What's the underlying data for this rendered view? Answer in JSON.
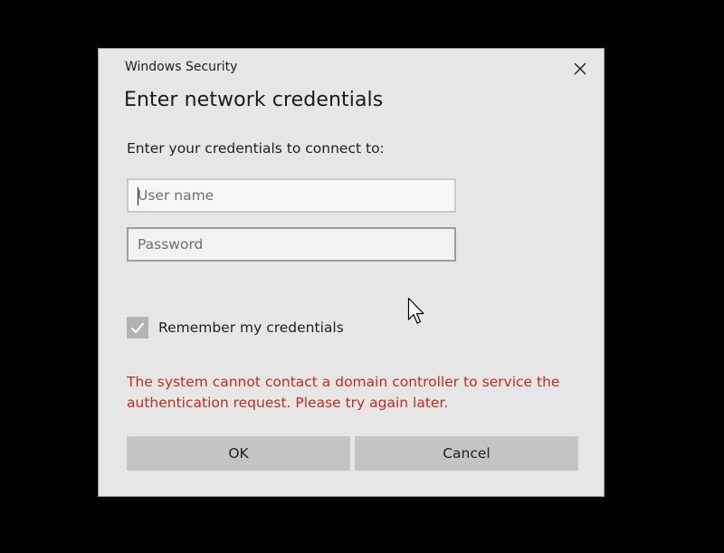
{
  "window": {
    "title": "Windows Security"
  },
  "dialog": {
    "heading": "Enter network credentials",
    "prompt": "Enter your credentials to connect to:"
  },
  "fields": {
    "username": {
      "value": "",
      "placeholder": "User name"
    },
    "password": {
      "value": "",
      "placeholder": "Password"
    }
  },
  "remember": {
    "label": "Remember my credentials",
    "checked": true
  },
  "error": {
    "message": "The system cannot contact a domain controller to service the authentication request. Please try again later."
  },
  "buttons": {
    "ok_label": "OK",
    "cancel_label": "Cancel"
  },
  "icons": {
    "close": "close-icon",
    "check": "checkmark-icon",
    "pointer": "mouse-pointer-icon"
  },
  "colors": {
    "error_text": "#c42b1c",
    "dialog_background": "#e6e6e6",
    "button_background": "#c4c4c4"
  }
}
